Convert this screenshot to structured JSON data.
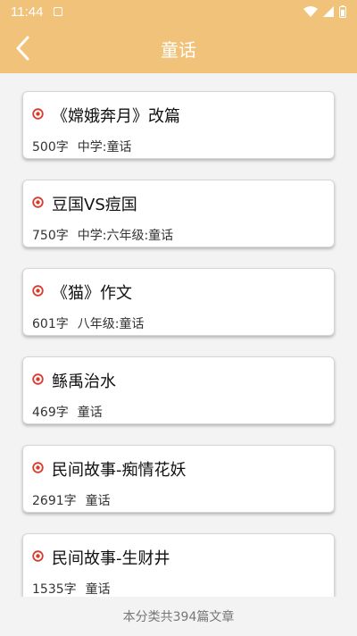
{
  "status_bar": {
    "time": "11:44"
  },
  "header": {
    "title": "童话"
  },
  "articles": [
    {
      "title": "《嫦娥奔月》改篇",
      "words": "500字",
      "category": "中学:童话"
    },
    {
      "title": "豆国VS痘国",
      "words": "750字",
      "category": "中学:六年级:童话"
    },
    {
      "title": "《猫》作文",
      "words": "601字",
      "category": "八年级:童话"
    },
    {
      "title": "鲧禹治水",
      "words": "469字",
      "category": "童话"
    },
    {
      "title": "民间故事-痴情花妖",
      "words": "2691字",
      "category": "童话"
    },
    {
      "title": "民间故事-生财井",
      "words": "1535字",
      "category": "童话"
    }
  ],
  "footer": {
    "summary": "本分类共394篇文章"
  },
  "colors": {
    "header_bg": "#f0c27a",
    "bullet": "#d93a2b"
  }
}
